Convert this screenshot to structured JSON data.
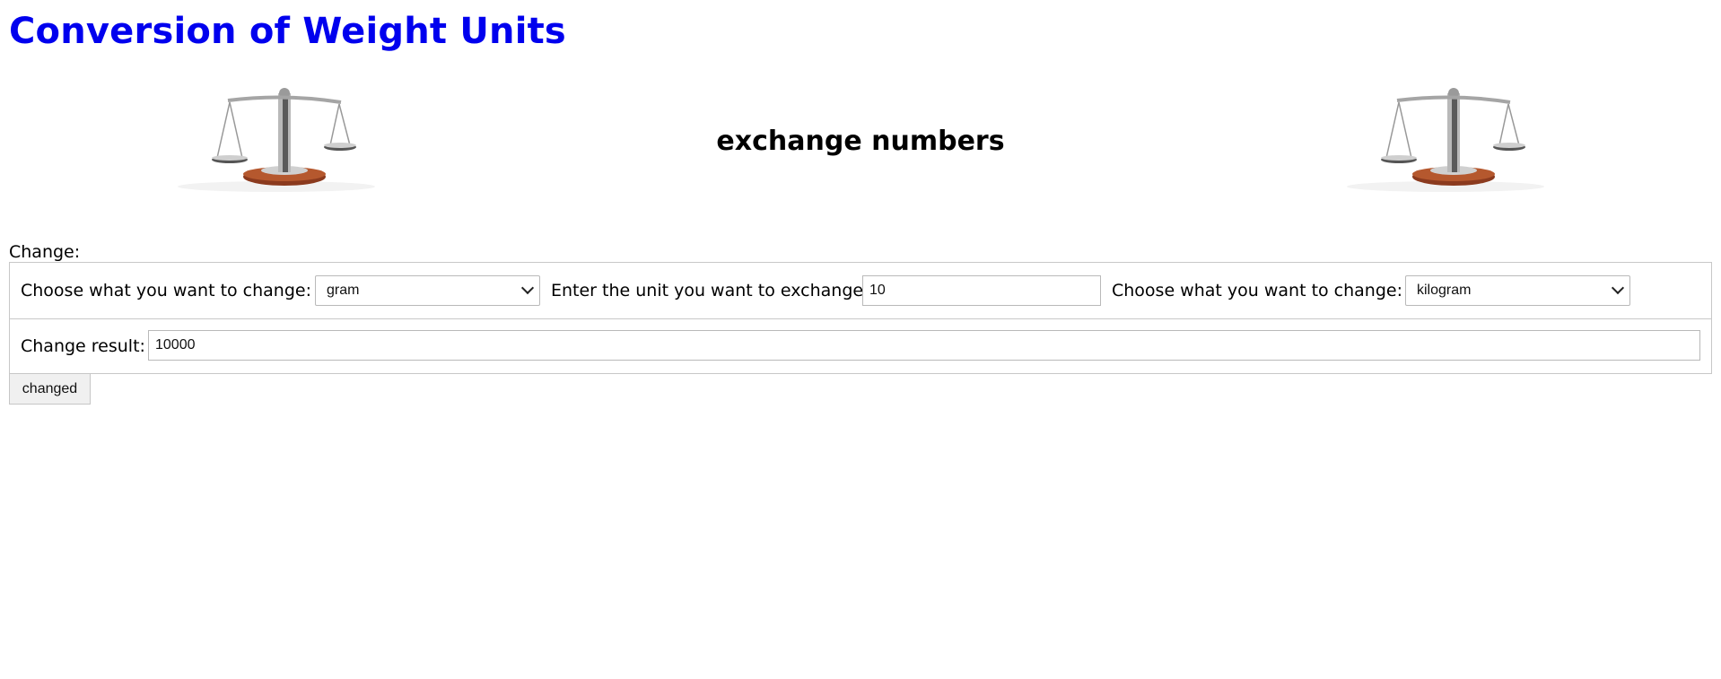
{
  "page": {
    "title": "Conversion of Weight Units",
    "banner_heading": "exchange numbers",
    "change_label": "Change:"
  },
  "icons": {
    "banner_left": "balance-scale-icon",
    "banner_right": "balance-scale-icon"
  },
  "form": {
    "from_label": "Choose what you want to change:",
    "from_value": "gram",
    "amount_label": "Enter the unit you want to exchange",
    "amount_value": "10",
    "to_label": "Choose what you want to change:",
    "to_value": "kilogram",
    "result_label": "Change result:",
    "result_value": "10000",
    "submit_label": "changed"
  },
  "colors": {
    "title": "#0000ee",
    "border": "#c8c8c8",
    "button_bg": "#f0f0f0"
  }
}
